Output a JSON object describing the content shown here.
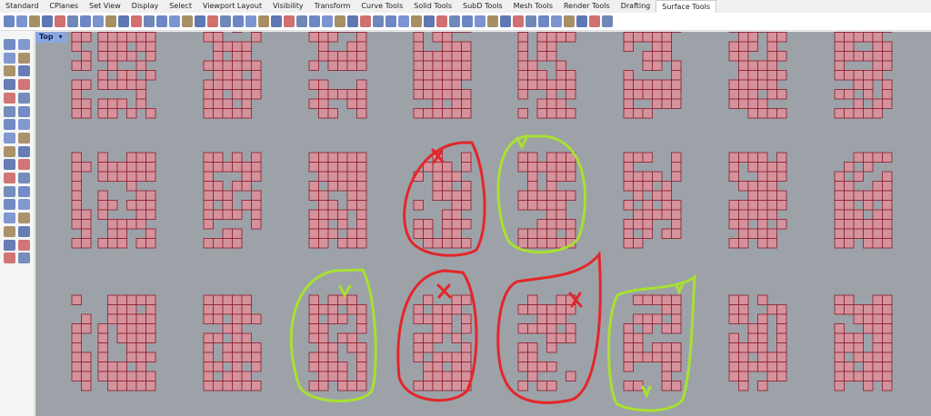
{
  "tabs": [
    "Standard",
    "CPlanes",
    "Set View",
    "Display",
    "Select",
    "Viewport Layout",
    "Visibility",
    "Transform",
    "Curve Tools",
    "Solid Tools",
    "SubD Tools",
    "Mesh Tools",
    "Render Tools",
    "Drafting",
    "Surface Tools"
  ],
  "active_tab": "Surface Tools",
  "viewport": {
    "name": "Top",
    "dropdown": "▾"
  },
  "colors": {
    "cell_fill": "#d4939c",
    "cell_line": "#8a1c2c",
    "viewport_bg": "#9da2a8",
    "reject": "#e3262a",
    "accept": "#a8e032"
  }
}
